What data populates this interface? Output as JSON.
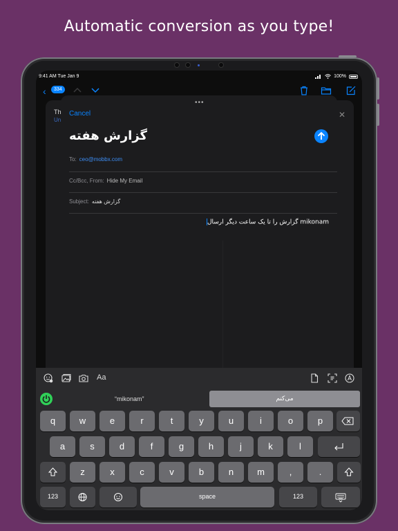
{
  "headline": "Automatic conversion as you type!",
  "status": {
    "time": "9:41 AM  Tue Jan 9",
    "battery": "100%"
  },
  "bg_mail": {
    "unread_count": "334",
    "preview_title": "Th",
    "preview_sub": "Un"
  },
  "compose": {
    "cancel_label": "Cancel",
    "title": "گزارش هفته",
    "to_label": "To:",
    "to_value": "ceo@mobbx.com",
    "cc_label": "Cc/Bcc, From:",
    "cc_value": "Hide My Email",
    "subject_label": "Subject:",
    "subject_value": "گزارش هفته",
    "body_text": "گزارش را تا یک ساعت دیگر ارسال mikonam"
  },
  "keyboard": {
    "aa_label": "Aa",
    "suggestion_original": "“mikonam”",
    "suggestion_converted": "می‌کنم",
    "row1": [
      "q",
      "w",
      "e",
      "r",
      "t",
      "y",
      "u",
      "i",
      "o",
      "p"
    ],
    "row2": [
      "a",
      "s",
      "d",
      "f",
      "g",
      "h",
      "j",
      "k",
      "l"
    ],
    "row3": [
      "z",
      "x",
      "c",
      "v",
      "b",
      "n",
      "m",
      ",",
      "."
    ],
    "numbers_label": "123",
    "space_label": "space"
  },
  "colors": {
    "background": "#6a3166",
    "accent": "#0a84ff",
    "power": "#30d158"
  }
}
